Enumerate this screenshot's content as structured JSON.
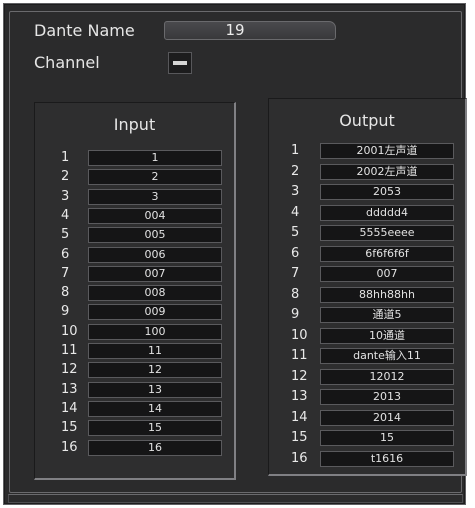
{
  "header": {
    "dante_name_label": "Dante Name",
    "dante_name_value": "19",
    "channel_label": "Channel"
  },
  "input": {
    "title": "Input",
    "rows": [
      {
        "num": "1",
        "value": "1"
      },
      {
        "num": "2",
        "value": "2"
      },
      {
        "num": "3",
        "value": "3"
      },
      {
        "num": "4",
        "value": "004"
      },
      {
        "num": "5",
        "value": "005"
      },
      {
        "num": "6",
        "value": "006"
      },
      {
        "num": "7",
        "value": "007"
      },
      {
        "num": "8",
        "value": "008"
      },
      {
        "num": "9",
        "value": "009"
      },
      {
        "num": "10",
        "value": "100"
      },
      {
        "num": "11",
        "value": "11"
      },
      {
        "num": "12",
        "value": "12"
      },
      {
        "num": "13",
        "value": "13"
      },
      {
        "num": "14",
        "value": "14"
      },
      {
        "num": "15",
        "value": "15"
      },
      {
        "num": "16",
        "value": "16"
      }
    ]
  },
  "output": {
    "title": "Output",
    "rows": [
      {
        "num": "1",
        "value": "2001左声道"
      },
      {
        "num": "2",
        "value": "2002左声道"
      },
      {
        "num": "3",
        "value": "2053"
      },
      {
        "num": "4",
        "value": "ddddd4"
      },
      {
        "num": "5",
        "value": "5555eeee"
      },
      {
        "num": "6",
        "value": "6f6f6f6f"
      },
      {
        "num": "7",
        "value": "007"
      },
      {
        "num": "8",
        "value": "88hh88hh"
      },
      {
        "num": "9",
        "value": "通道5"
      },
      {
        "num": "10",
        "value": "10通道"
      },
      {
        "num": "11",
        "value": "dante输入11"
      },
      {
        "num": "12",
        "value": "12012"
      },
      {
        "num": "13",
        "value": "2013"
      },
      {
        "num": "14",
        "value": "2014"
      },
      {
        "num": "15",
        "value": "15"
      },
      {
        "num": "16",
        "value": "t1616"
      }
    ]
  }
}
